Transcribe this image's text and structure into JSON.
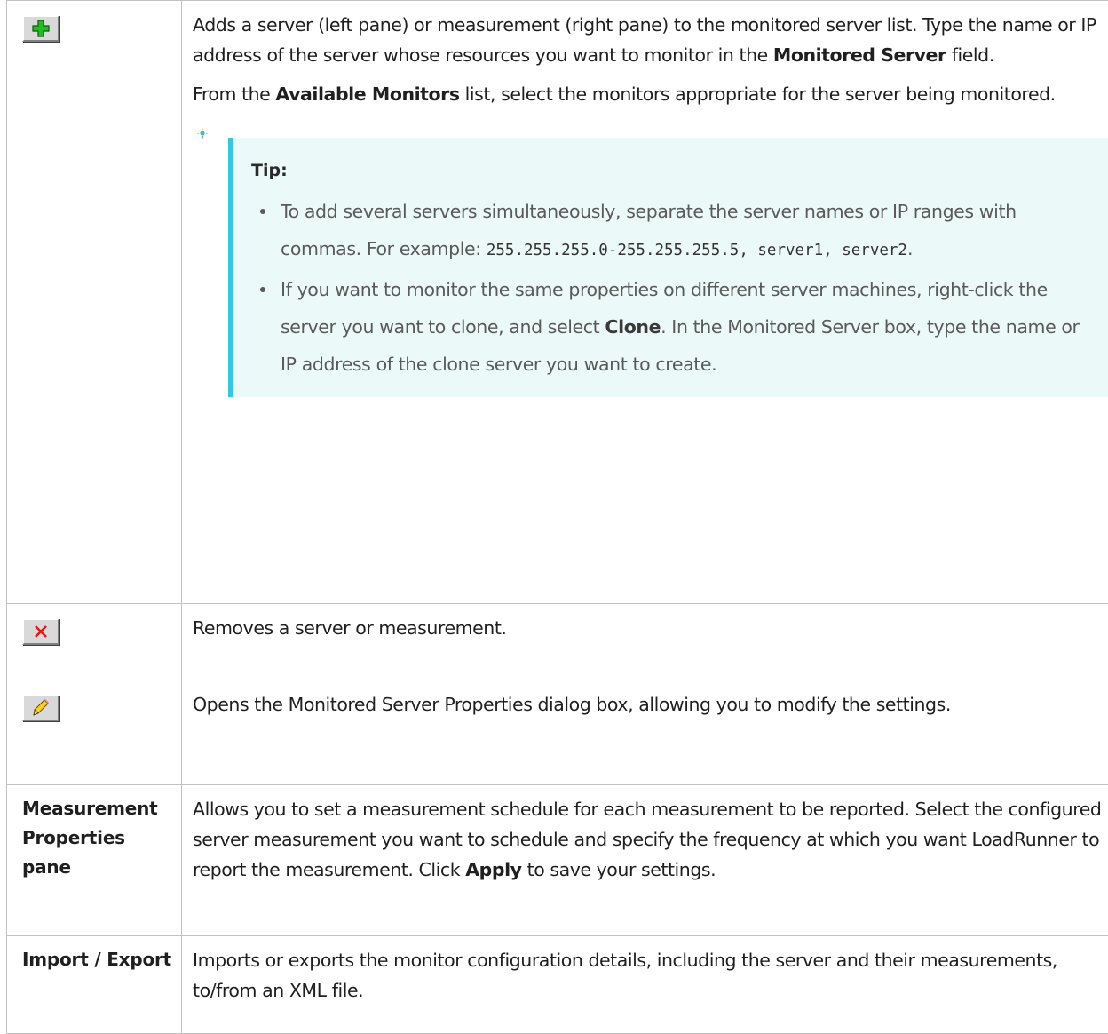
{
  "rows": [
    {
      "icon": "add-plus-icon",
      "paragraphs": [
        {
          "pre": "Adds a server (left pane) or measurement (right pane) to the monitored server list. Type the name or IP address of the server whose resources you want to monitor in the ",
          "bold": "Monitored Server",
          "post": " field."
        },
        {
          "pre": "From the ",
          "bold": "Available Monitors",
          "post": " list, select the monitors appropriate for the server being monitored."
        }
      ],
      "tip": {
        "icon": "lightbulb-icon",
        "title": "Tip:",
        "item1": {
          "pre": "To add several servers simultaneously, separate the server names or IP ranges with commas. For example: ",
          "code": "255.255.255.0-255.255.255.5, server1, server2",
          "post": "."
        },
        "item2": {
          "pre": "If you want to monitor the same properties on different server machines, right-click the server you want to clone, and select ",
          "bold": "Clone",
          "post": ". In the Monitored Server box, type the name or IP address of the clone server you want to create."
        }
      }
    },
    {
      "icon": "remove-x-icon",
      "text": "Removes a server or measurement."
    },
    {
      "icon": "edit-pencil-icon",
      "text": "Opens the Monitored Server Properties dialog box, allowing you to modify the settings."
    },
    {
      "term": "Measurement Properties pane",
      "pre": "Allows you to set a measurement schedule for each measurement to be reported. Select the configured server measurement you want to schedule and specify the frequency at which you want LoadRunner to report the measurement. Click ",
      "bold": "Apply",
      "post": " to save your settings."
    },
    {
      "term": "Import / Export",
      "text": "Imports or exports the monitor configuration details, including the server and their measurements, to/from an XML file."
    }
  ]
}
